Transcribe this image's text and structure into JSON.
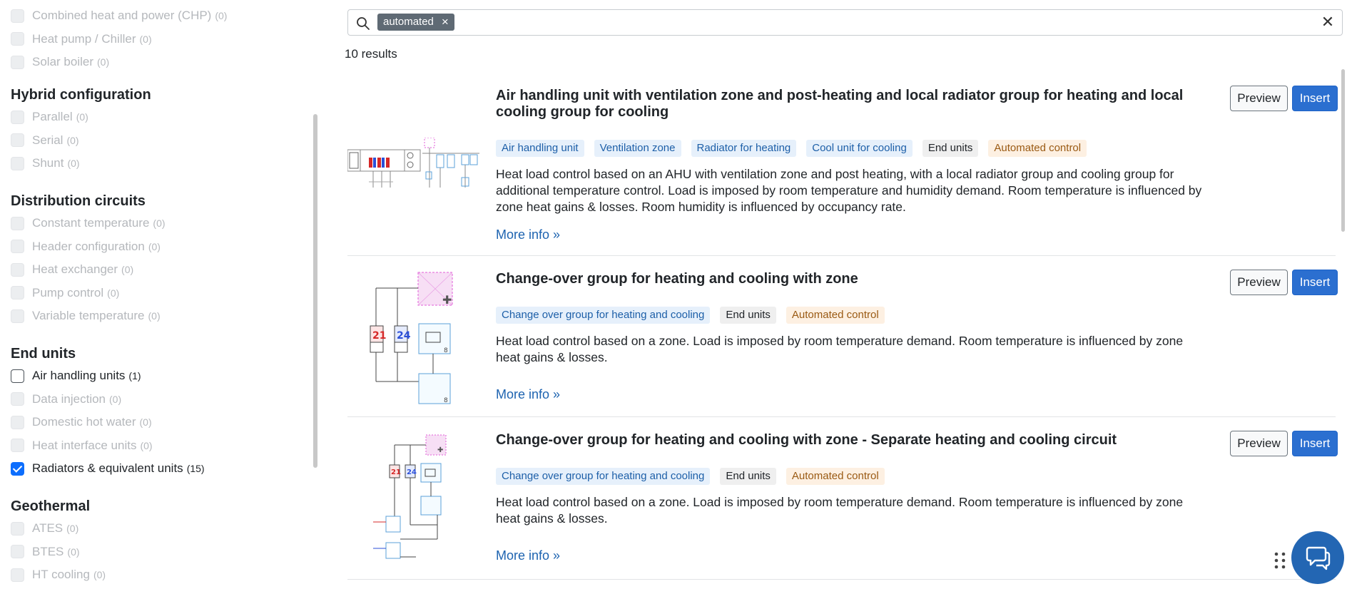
{
  "sidebar": {
    "groups": [
      {
        "title": "",
        "options": [
          {
            "label": "Combined heat and power (CHP)",
            "count": "(0)",
            "state": "disabled"
          },
          {
            "label": "Heat pump / Chiller",
            "count": "(0)",
            "state": "disabled"
          },
          {
            "label": "Solar boiler",
            "count": "(0)",
            "state": "disabled"
          }
        ]
      },
      {
        "title": "Hybrid configuration",
        "options": [
          {
            "label": "Parallel",
            "count": "(0)",
            "state": "disabled"
          },
          {
            "label": "Serial",
            "count": "(0)",
            "state": "disabled"
          },
          {
            "label": "Shunt",
            "count": "(0)",
            "state": "disabled"
          }
        ]
      },
      {
        "title": "Distribution circuits",
        "options": [
          {
            "label": "Constant temperature",
            "count": "(0)",
            "state": "disabled"
          },
          {
            "label": "Header configuration",
            "count": "(0)",
            "state": "disabled"
          },
          {
            "label": "Heat exchanger",
            "count": "(0)",
            "state": "disabled"
          },
          {
            "label": "Pump control",
            "count": "(0)",
            "state": "disabled"
          },
          {
            "label": "Variable temperature",
            "count": "(0)",
            "state": "disabled"
          }
        ]
      },
      {
        "title": "End units",
        "options": [
          {
            "label": "Air handling units",
            "count": "(1)",
            "state": "enabled"
          },
          {
            "label": "Data injection",
            "count": "(0)",
            "state": "disabled"
          },
          {
            "label": "Domestic hot water",
            "count": "(0)",
            "state": "disabled"
          },
          {
            "label": "Heat interface units",
            "count": "(0)",
            "state": "disabled"
          },
          {
            "label": "Radiators & equivalent units",
            "count": "(15)",
            "state": "checked"
          }
        ]
      },
      {
        "title": "Geothermal",
        "options": [
          {
            "label": "ATES",
            "count": "(0)",
            "state": "disabled"
          },
          {
            "label": "BTES",
            "count": "(0)",
            "state": "disabled"
          },
          {
            "label": "HT cooling",
            "count": "(0)",
            "state": "disabled"
          }
        ]
      }
    ]
  },
  "search": {
    "chip": "automated",
    "chip_remove": "×",
    "clear": "✕",
    "icon": "search-icon"
  },
  "results": {
    "count_text": "10 results",
    "items": [
      {
        "title": "Air handling unit with ventilation zone and post-heating and local radiator group for heating and local cooling group for cooling",
        "tags": [
          {
            "label": "Air handling unit",
            "color": "blue"
          },
          {
            "label": "Ventilation zone",
            "color": "blue"
          },
          {
            "label": "Radiator for heating",
            "color": "blue"
          },
          {
            "label": "Cool unit for cooling",
            "color": "blue"
          },
          {
            "label": "End units",
            "color": "gray"
          },
          {
            "label": "Automated control",
            "color": "orange"
          }
        ],
        "description": "Heat load control based on an AHU with ventilation zone and post heating, with a local radiator group and cooling group for additional temperature control. Load is imposed by room temperature and humidity demand. Room temperature is influenced by zone heat gains & losses. Room humidity is influenced by occupancy rate.",
        "more": "More info »",
        "preview": "Preview",
        "insert": "Insert"
      },
      {
        "title": "Change-over group for heating and cooling with zone",
        "tags": [
          {
            "label": "Change over group for heating and cooling",
            "color": "blue"
          },
          {
            "label": "End units",
            "color": "gray"
          },
          {
            "label": "Automated control",
            "color": "orange"
          }
        ],
        "description": "Heat load control based on a zone. Load is imposed by room temperature demand. Room temperature is influenced by zone heat gains & losses.",
        "more": "More info »",
        "preview": "Preview",
        "insert": "Insert",
        "thumb_labels": [
          "21",
          "24",
          "8",
          "8"
        ]
      },
      {
        "title": "Change-over group for heating and cooling with zone - Separate heating and cooling circuit",
        "tags": [
          {
            "label": "Change over group for heating and cooling",
            "color": "blue"
          },
          {
            "label": "End units",
            "color": "gray"
          },
          {
            "label": "Automated control",
            "color": "orange"
          }
        ],
        "description": "Heat load control based on a zone. Load is imposed by room temperature demand. Room temperature is influenced by zone heat gains & losses.",
        "more": "More info »",
        "preview": "Preview",
        "insert": "Insert",
        "thumb_labels": [
          "21",
          "24"
        ]
      }
    ]
  },
  "colors": {
    "accent": "#2b6fd0",
    "link": "#1d63b0",
    "chip": "#5f6a74",
    "fab": "#2366b3"
  },
  "icons": {
    "chat": "chat-bubbles-icon",
    "drag": "drag-handle-icon"
  }
}
